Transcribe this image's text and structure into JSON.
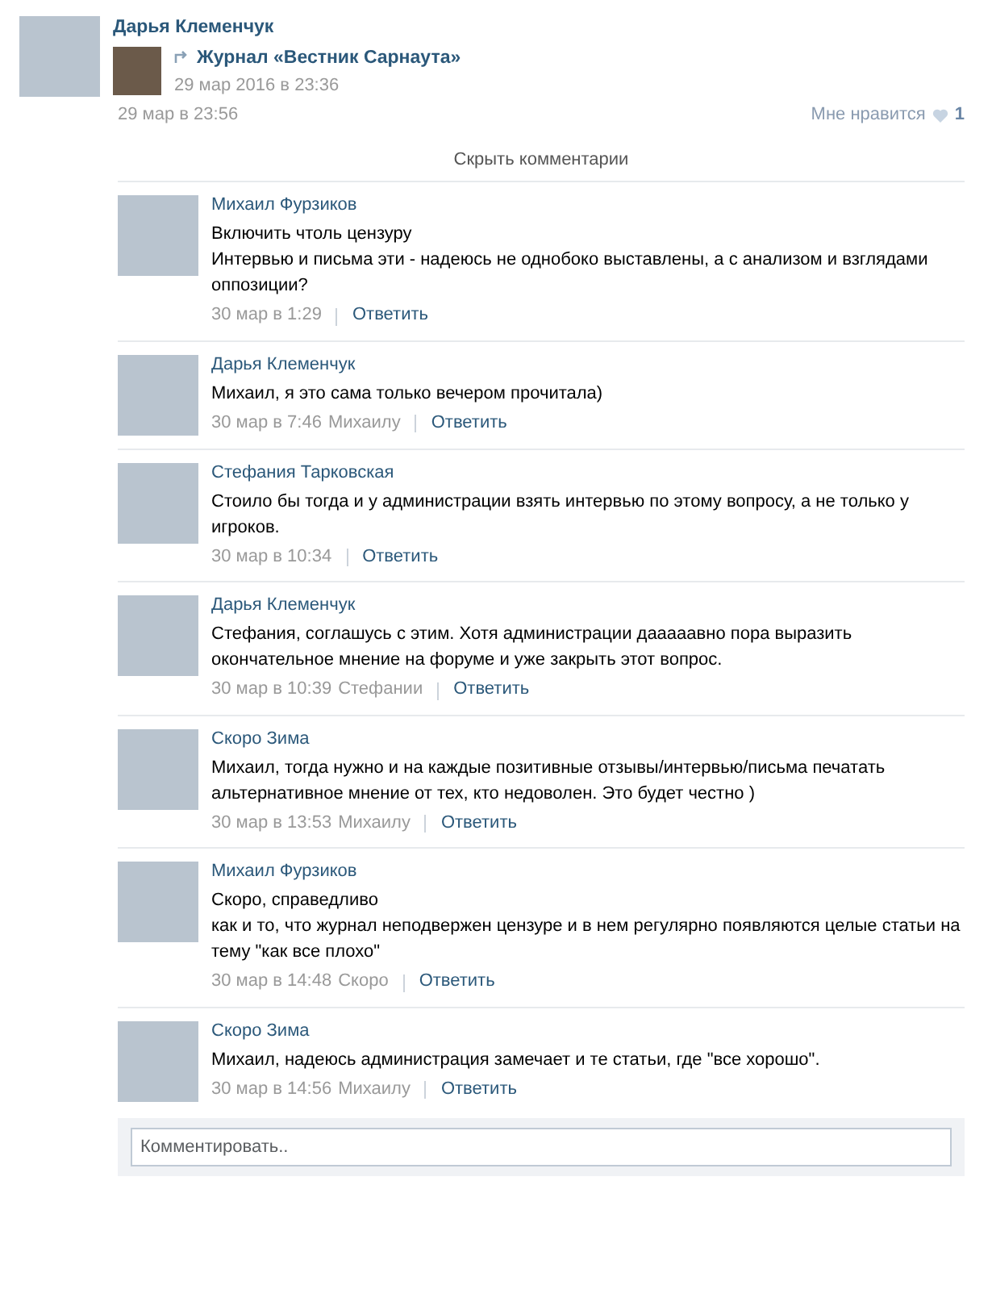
{
  "post": {
    "author": "Дарья Клеменчук",
    "repost": {
      "title": "Журнал «Вестник Сарнаута»",
      "date": "29 мар 2016 в 23:36"
    },
    "date": "29 мар в 23:56",
    "like": {
      "label": "Мне нравится",
      "count": "1"
    }
  },
  "hide_comments": "Скрыть комментарии",
  "comments": [
    {
      "author": "Михаил Фурзиков",
      "text": [
        "Включить чтоль цензуру",
        "Интервью и письма эти - надеюсь не однобоко выставлены, а с анализом и взглядами оппозиции?"
      ],
      "date": "30 мар в 1:29",
      "reply": "Ответить"
    },
    {
      "author": "Дарья Клеменчук",
      "text": [
        "Михаил, я это сама только вечером прочитала)"
      ],
      "date": "30 мар в 7:46",
      "to": "Михаилу",
      "reply": "Ответить"
    },
    {
      "author": "Стефания Тарковская",
      "text": [
        "Стоило бы тогда и у администрации взять интервью по этому вопросу, а не только у игроков."
      ],
      "date": "30 мар в 10:34",
      "reply": "Ответить"
    },
    {
      "author": "Дарья Клеменчук",
      "text": [
        "Стефания, соглашусь с этим. Хотя администрации дааааавно пора выразить окончательное мнение на форуме и уже закрыть этот вопрос."
      ],
      "date": "30 мар в 10:39",
      "to": "Стефании",
      "reply": "Ответить"
    },
    {
      "author": "Скоро Зима",
      "text": [
        "Михаил, тогда нужно и на каждые позитивные отзывы/интервью/письма печатать альтернативное мнение от тех, кто недоволен. Это будет честно )"
      ],
      "date": "30 мар в 13:53",
      "to": "Михаилу",
      "reply": "Ответить"
    },
    {
      "author": "Михаил Фурзиков",
      "text": [
        "Скоро, справедливо",
        "как и то, что журнал неподвержен цензуре и в нем регулярно появляются целые статьи на тему \"как все плохо\""
      ],
      "date": "30 мар в 14:48",
      "to": "Скоро",
      "reply": "Ответить"
    },
    {
      "author": "Скоро Зима",
      "text": [
        "Михаил, надеюсь администрация замечает и те статьи, где \"все хорошо\"."
      ],
      "date": "30 мар в 14:56",
      "to": "Михаилу",
      "reply": "Ответить"
    }
  ],
  "comment_field": {
    "placeholder": "Комментировать.."
  }
}
